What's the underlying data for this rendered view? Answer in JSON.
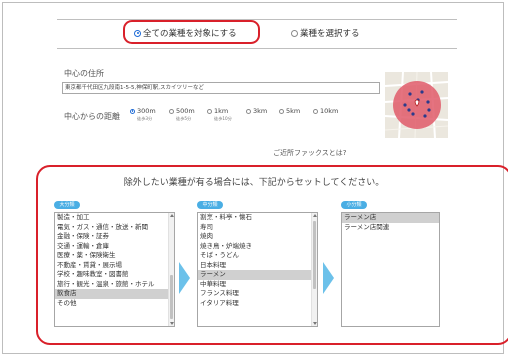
{
  "target": {
    "all_label": "全ての業種を対象にする",
    "select_label": "業種を選択する"
  },
  "center_address": {
    "label": "中心の住所",
    "placeholder": "東京都千代田区九段南1-5-5,神保町駅,スカイツリーなど"
  },
  "distance": {
    "label": "中心からの距離",
    "options": [
      {
        "value": "300m",
        "note": "徒歩3分"
      },
      {
        "value": "500m",
        "note": "徒歩5分"
      },
      {
        "value": "1km",
        "note": "徒歩10分"
      },
      {
        "value": "3km",
        "note": ""
      },
      {
        "value": "5km",
        "note": ""
      },
      {
        "value": "10km",
        "note": ""
      }
    ]
  },
  "fax_link": "ご近所ファックスとは?",
  "exclude": {
    "title": "除外したい業種が有る場合には、下記からセットしてください。",
    "major": {
      "badge": "大分類",
      "items": [
        "製造・加工",
        "電気・ガス・通信・放送・新聞",
        "金融・保険・証券",
        "交通・運輸・倉庫",
        "医療・薬・保険衛生",
        "不動産・賃貸・展示場",
        "学校・趣味教室・図書館",
        "旅行・観光・温泉・旅館・ホテル",
        "飲食店",
        "その他"
      ],
      "selected": "飲食店"
    },
    "middle": {
      "badge": "中分類",
      "items": [
        "割烹・料亭・懐石",
        "寿司",
        "焼肉",
        "焼き鳥・炉端焼き",
        "そば・うどん",
        "日本料理",
        "ラーメン",
        "中華料理",
        "フランス料理",
        "イタリア料理"
      ],
      "selected": "ラーメン"
    },
    "minor": {
      "badge": "小分類",
      "items": [
        "ラーメン店",
        "ラーメン店関連"
      ],
      "selected": "ラーメン店"
    }
  },
  "colors": {
    "highlight_red": "#d9202a",
    "badge_blue": "#4aaee4",
    "arrow_blue": "#6cc1ea",
    "map_circle": "#e05a6a"
  }
}
